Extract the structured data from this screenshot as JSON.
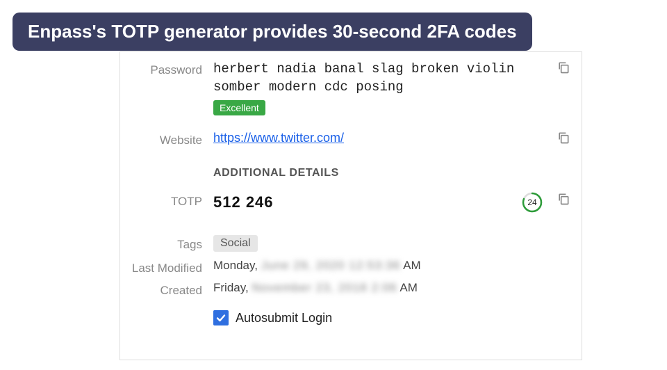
{
  "caption": "Enpass's TOTP generator provides 30-second 2FA codes",
  "labels": {
    "password": "Password",
    "website": "Website",
    "totp": "TOTP",
    "tags": "Tags",
    "last_modified": "Last Modified",
    "created": "Created"
  },
  "password": {
    "value": "herbert nadia banal slag broken violin somber modern cdc posing",
    "strength": "Excellent"
  },
  "website": {
    "url": "https://www.twitter.com/"
  },
  "section_heading": "ADDITIONAL DETAILS",
  "totp": {
    "code": "512  246",
    "countdown": "24"
  },
  "tags": [
    "Social"
  ],
  "last_modified": {
    "day": "Monday,",
    "obscured": "June 29, 2020 12:53:36",
    "suffix": "AM"
  },
  "created": {
    "day": "Friday,",
    "obscured": "November 23, 2018 2:06",
    "suffix": "AM"
  },
  "autosubmit": {
    "label": "Autosubmit Login",
    "checked": true
  }
}
